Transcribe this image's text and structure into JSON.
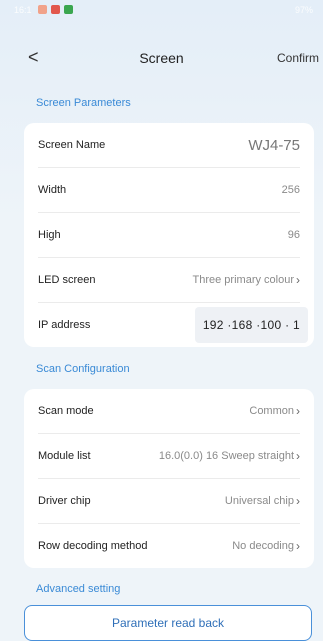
{
  "status": {
    "time": "16:1",
    "right": "97%"
  },
  "nav": {
    "back_icon": "<",
    "title": "Screen",
    "confirm": "Confirm"
  },
  "sections": {
    "screen_parameters": "Screen Parameters",
    "scan_configuration": "Scan Configuration",
    "advanced_setting": "Advanced setting"
  },
  "screen_params": [
    {
      "label": "Screen Name",
      "value": "WJ4-75"
    },
    {
      "label": "Width",
      "value": "256"
    },
    {
      "label": "High",
      "value": "96"
    },
    {
      "label": "LED screen",
      "value": "Three primary colour"
    },
    {
      "label": "IP address",
      "value": "192 ·168 ·100 · 1"
    }
  ],
  "scan_config": [
    {
      "label": "Scan mode",
      "value": "Common"
    },
    {
      "label": "Module list",
      "value": "16.0(0.0) 16 Sweep straight"
    },
    {
      "label": "Driver chip",
      "value": "Universal chip"
    },
    {
      "label": "Row decoding method",
      "value": "No decoding"
    }
  ],
  "buttons": {
    "read_back": "Parameter read back"
  },
  "colors": {
    "accent": "#3a8ad6",
    "background": "#eef4f9"
  }
}
